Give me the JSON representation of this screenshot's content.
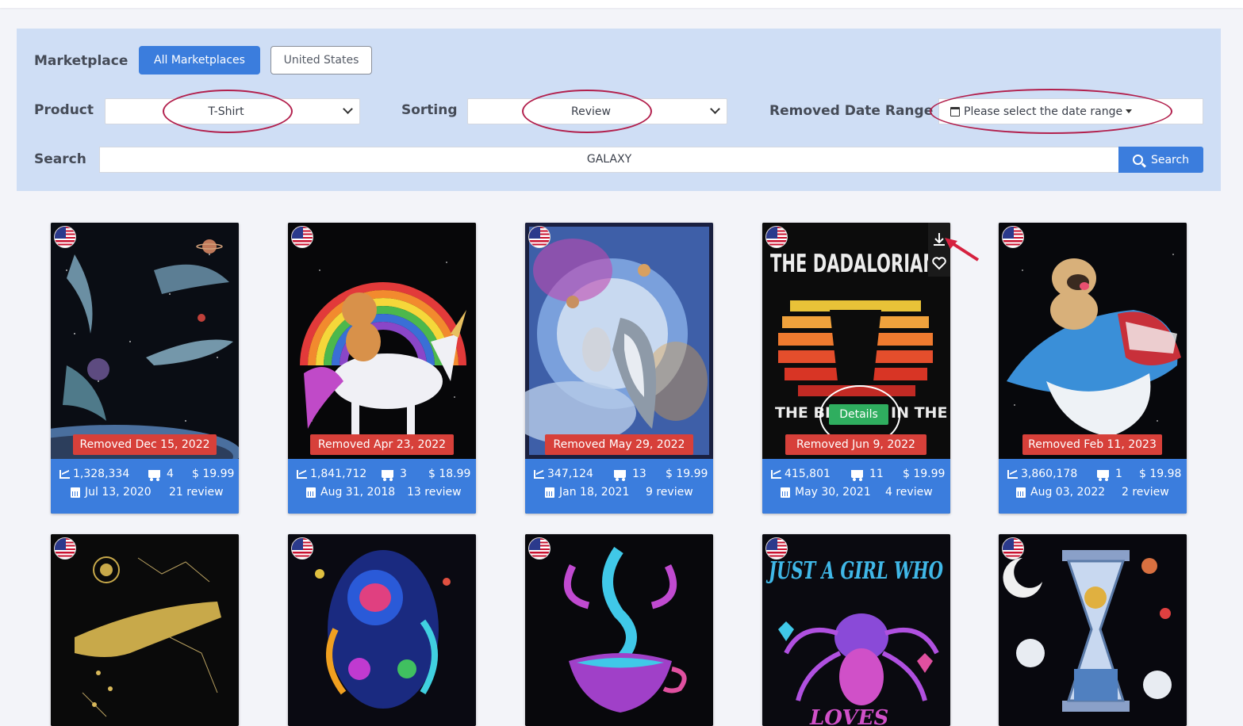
{
  "filters": {
    "marketplace_label": "Marketplace",
    "marketplace_buttons": [
      {
        "label": "All Marketplaces",
        "active": true
      },
      {
        "label": "United States",
        "active": false
      }
    ],
    "product_label": "Product",
    "product_value": "T-Shirt",
    "sorting_label": "Sorting",
    "sorting_value": "Review",
    "date_range_label": "Removed Date Range",
    "date_range_placeholder": "Please select the date range",
    "search_label": "Search",
    "search_value": "GALAXY",
    "search_button": "Search"
  },
  "colors": {
    "primary": "#3b7ddd",
    "panel": "#cfdef5",
    "removed_badge": "#d7403a",
    "details_button": "#2fae5f",
    "highlight_ellipse": "#b2204d"
  },
  "products": [
    {
      "removed": "Removed Dec 15, 2022",
      "rank": "1,328,334",
      "sales": "4",
      "price": "$ 19.99",
      "date": "Jul 13, 2020",
      "reviews": "21 review",
      "flag": "us-flag-icon"
    },
    {
      "removed": "Removed Apr 23, 2022",
      "rank": "1,841,712",
      "sales": "3",
      "price": "$ 18.99",
      "date": "Aug 31, 2018",
      "reviews": "13 review",
      "flag": "us-flag-icon"
    },
    {
      "removed": "Removed May 29, 2022",
      "rank": "347,124",
      "sales": "13",
      "price": "$ 19.99",
      "date": "Jan 18, 2021",
      "reviews": "9 review",
      "flag": "us-flag-icon"
    },
    {
      "removed": "Removed Jun 9, 2022",
      "rank": "415,801",
      "sales": "11",
      "price": "$ 19.99",
      "date": "May 30, 2021",
      "reviews": "4 review",
      "flag": "us-flag-icon",
      "details": "Details"
    },
    {
      "removed": "Removed Feb 11, 2023",
      "rank": "3,860,178",
      "sales": "1",
      "price": "$ 19.98",
      "date": "Aug 03, 2022",
      "reviews": "2 review",
      "flag": "us-flag-icon"
    }
  ],
  "artwork": {
    "card4_title": "THE DADALORIAN",
    "card4_line": "THE BE",
    "card4_line2": "IN THE",
    "card9_text": "JUST A GIRL WHO",
    "card9_bottom": "LOVES"
  }
}
